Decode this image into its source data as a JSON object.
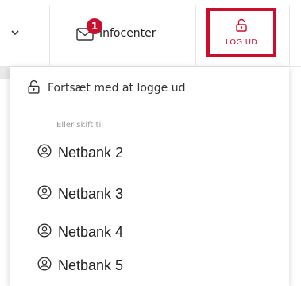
{
  "topbar": {
    "infocenter": {
      "label": "Infocenter",
      "badge_count": "1",
      "icon": "envelope-icon"
    },
    "logout": {
      "label": "LOG UD",
      "icon": "unlock-icon"
    },
    "expand_icon": "chevron-down-icon"
  },
  "dropdown": {
    "continue_label": "Fortsæt med at logge ud",
    "continue_icon": "unlock-icon",
    "section_label": "Eller skift til",
    "accounts": [
      {
        "label": "Netbank 2",
        "icon": "user-circle-icon"
      },
      {
        "label": "Netbank 3",
        "icon": "user-circle-icon"
      },
      {
        "label": "Netbank 4",
        "icon": "user-circle-icon"
      },
      {
        "label": "Netbank 5",
        "icon": "user-circle-icon"
      }
    ]
  },
  "colors": {
    "accent": "#c8102e",
    "text": "#222222",
    "muted": "#9a9a9a"
  }
}
